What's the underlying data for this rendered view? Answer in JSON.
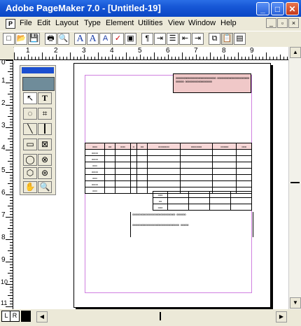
{
  "window": {
    "title": "Adobe PageMaker 7.0 - [Untitled-19]",
    "min_glyph": "_",
    "max_glyph": "□",
    "close_glyph": "✕"
  },
  "menu": {
    "items": [
      "File",
      "Edit",
      "Layout",
      "Type",
      "Element",
      "Utilities",
      "View",
      "Window",
      "Help"
    ],
    "mdi_controls": [
      "_",
      "▫",
      "×"
    ]
  },
  "toolbar": {
    "buttons": [
      "new-icon",
      "open-icon",
      "save-icon",
      "print-icon",
      "find-icon",
      "A",
      "A+",
      "A-",
      "spell-icon",
      "frame-icon",
      "pilcrow-icon",
      "indent-icon",
      "bullets-icon",
      "outdent-icon",
      "increase-indent-icon",
      "copy-icon",
      "paste-icon",
      "page-icon"
    ],
    "glyphs": [
      "□",
      "📂",
      "💾",
      "🖶",
      "🔍",
      "A",
      "A",
      "A",
      "✓",
      "▣",
      "¶",
      "⇥",
      "☰",
      "⇤",
      "⇥",
      "⧉",
      "📋",
      "▤"
    ]
  },
  "rulers": {
    "horizontal_numbers": [
      "1",
      "2",
      "3",
      "4",
      "5",
      "6",
      "7",
      "8",
      "9"
    ],
    "vertical_numbers": [
      "0",
      "1",
      "2",
      "3",
      "4",
      "5",
      "6",
      "7",
      "8",
      "9",
      "10",
      "11"
    ]
  },
  "toolbox": {
    "tools": [
      "pointer-tool",
      "text-tool",
      "rotate-tool",
      "crop-tool",
      "line-tool",
      "constrained-line-tool",
      "rectangle-tool",
      "rectangle-frame-tool",
      "ellipse-tool",
      "ellipse-frame-tool",
      "polygon-tool",
      "polygon-frame-tool",
      "hand-tool",
      "zoom-tool"
    ],
    "glyphs": [
      "↖",
      "T",
      "◌",
      "⌗",
      "╲",
      "┃",
      "▭",
      "⊠",
      "◯",
      "⊗",
      "⬡",
      "⊛",
      "✋",
      "🔍"
    ]
  },
  "page_content": {
    "header_box_text": "oooooooooooooooooooooooooooooo oooooooooooooooooooooooooooooo oooooooooooooooooooo",
    "table_header": [
      "ooo",
      "oo",
      "ooo",
      "o",
      "oo",
      "ooooooo",
      "ooooooo",
      "ooooo",
      "ooo"
    ],
    "row_labels": [
      "oooo",
      "oooo",
      "ooo",
      "oooo",
      "ooo",
      "oooo",
      "ooo"
    ],
    "sub_row_labels": [
      "ooo",
      "oo",
      "ooo"
    ],
    "footer_line1": "oooooooooooooooooooooooooooooooo        ooooooo",
    "footer_line2": "ooooooooooooooooooooooooooooooooooo      oooooo"
  },
  "statusbar": {
    "page_icon_left": "L",
    "page_icon_right": "R"
  },
  "colors": {
    "title_blue": "#0a46c4",
    "margin_guide": "#d080e0",
    "header_fill": "#f0c8c8",
    "table_header_fill": "#f8d8d8"
  }
}
